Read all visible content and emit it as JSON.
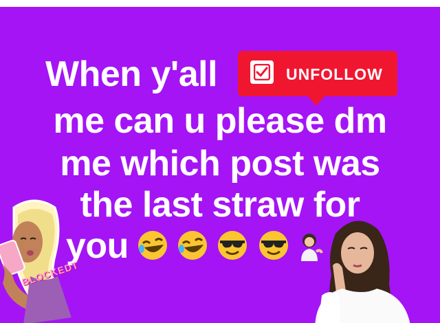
{
  "meme": {
    "line1_prefix": "When y'all",
    "badge_label": "UNFOLLOW",
    "line2": "me can u please dm",
    "line3": "me which post was",
    "line4": "the last straw for",
    "line5": "you",
    "sticker_text": "BLOCKEDT"
  },
  "colors": {
    "background": "#a414f5",
    "badge": "#f11630",
    "text": "#ffffff"
  },
  "emojis": [
    "rolling-on-floor-laughing",
    "rolling-on-floor-laughing",
    "smiling-face-with-sunglasses",
    "smiling-face-with-sunglasses",
    "person-tipping-hand"
  ],
  "icons": [
    "checkbox-icon"
  ]
}
